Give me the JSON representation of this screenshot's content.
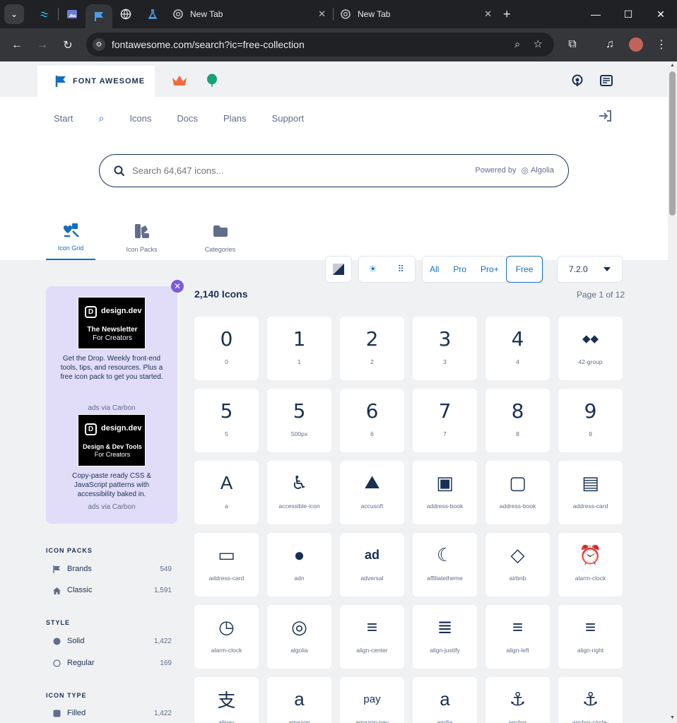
{
  "browser": {
    "tabs": [
      {
        "title": "New Tab"
      },
      {
        "title": "New Tab"
      }
    ],
    "address": "fontawesome.com/search?ic=free-collection"
  },
  "header": {
    "brand": "FONT AWESOME",
    "nav": [
      "Start",
      "Icons",
      "Docs",
      "Plans",
      "Support"
    ]
  },
  "search": {
    "placeholder": "Search 64,647 icons...",
    "powered_by": "Powered by",
    "provider": "Algolia"
  },
  "view_tabs": [
    {
      "label": "Icon Grid"
    },
    {
      "label": "Icon Packs"
    },
    {
      "label": "Categories"
    }
  ],
  "filters": {
    "options": [
      "All",
      "Pro",
      "Pro+",
      "Free"
    ],
    "selected": "Free",
    "version": "7.2.0"
  },
  "ads": [
    {
      "brand": "design.dev",
      "tag1": "The Newsletter",
      "tag2": "For Creators",
      "text": "Get the Drop. Weekly front-end tools, tips, and resources. Plus a free icon pack to get you started.",
      "via": "ads via Carbon"
    },
    {
      "brand": "design.dev",
      "tag1": "Design & Dev Tools",
      "tag2": "For Creators",
      "text": "Copy-paste ready CSS & JavaScript patterns with accessibility baked in.",
      "via": "ads via Carbon"
    }
  ],
  "sidebar": {
    "icon_packs_title": "ICON PACKS",
    "icon_packs": [
      {
        "label": "Brands",
        "count": "549"
      },
      {
        "label": "Classic",
        "count": "1,591"
      }
    ],
    "style_title": "STYLE",
    "style": [
      {
        "label": "Solid",
        "count": "1,422"
      },
      {
        "label": "Regular",
        "count": "169"
      }
    ],
    "icon_type_title": "ICON TYPE",
    "icon_type": [
      {
        "label": "Filled",
        "count": "1,422"
      }
    ]
  },
  "results": {
    "count": "2,140 Icons",
    "page": "Page 1 of 12"
  },
  "icons": [
    {
      "name": "0",
      "glyph": "0"
    },
    {
      "name": "1",
      "glyph": "1"
    },
    {
      "name": "2",
      "glyph": "2"
    },
    {
      "name": "3",
      "glyph": "3"
    },
    {
      "name": "4",
      "glyph": "4"
    },
    {
      "name": "42-group",
      "glyph": "◆◆"
    },
    {
      "name": "5",
      "glyph": "5"
    },
    {
      "name": "500px",
      "glyph": "5"
    },
    {
      "name": "6",
      "glyph": "6"
    },
    {
      "name": "7",
      "glyph": "7"
    },
    {
      "name": "8",
      "glyph": "8"
    },
    {
      "name": "9",
      "glyph": "9"
    },
    {
      "name": "a",
      "glyph": "A"
    },
    {
      "name": "accessible-icon",
      "glyph": "♿"
    },
    {
      "name": "accusoft",
      "glyph": "⛰"
    },
    {
      "name": "address-book",
      "glyph": "▣"
    },
    {
      "name": "address-book",
      "glyph": "▢"
    },
    {
      "name": "address-card",
      "glyph": "▤"
    },
    {
      "name": "address-card",
      "glyph": "▭"
    },
    {
      "name": "adn",
      "glyph": "●"
    },
    {
      "name": "adversal",
      "glyph": "ad"
    },
    {
      "name": "affiliatetheme",
      "glyph": "☾"
    },
    {
      "name": "airbnb",
      "glyph": "◇"
    },
    {
      "name": "alarm-clock",
      "glyph": "⏰"
    },
    {
      "name": "alarm-clock",
      "glyph": "◷"
    },
    {
      "name": "algolia",
      "glyph": "◎"
    },
    {
      "name": "align-center",
      "glyph": "≡"
    },
    {
      "name": "align-justify",
      "glyph": "≣"
    },
    {
      "name": "align-left",
      "glyph": "≡"
    },
    {
      "name": "align-right",
      "glyph": "≡"
    },
    {
      "name": "alipay",
      "glyph": "支"
    },
    {
      "name": "amazon",
      "glyph": "a"
    },
    {
      "name": "amazon-pay",
      "glyph": "pay"
    },
    {
      "name": "amilia",
      "glyph": "a"
    },
    {
      "name": "anchor",
      "glyph": "⚓"
    },
    {
      "name": "anchor-circle-",
      "glyph": "⚓"
    }
  ]
}
